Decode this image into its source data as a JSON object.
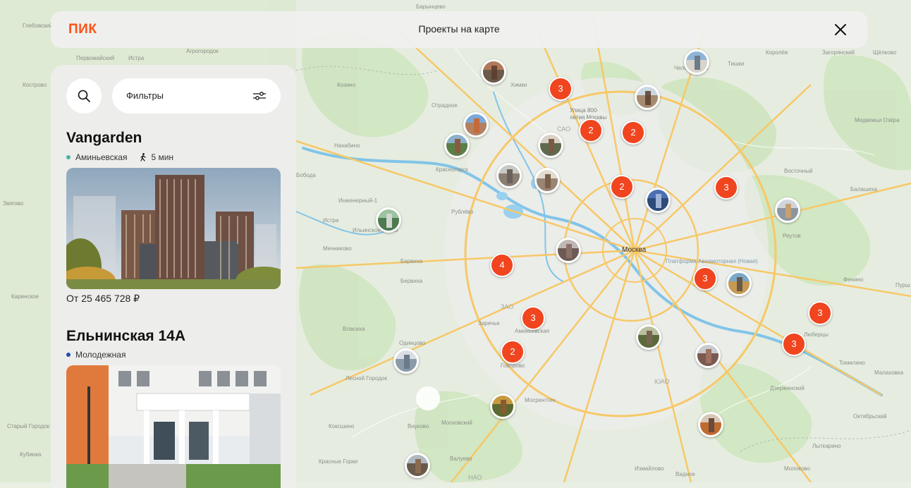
{
  "header": {
    "logo": "ПИК",
    "title": "Проекты на карте"
  },
  "search": {
    "icon": "search-icon"
  },
  "filters": {
    "label": "Фильтры",
    "icon": "sliders-icon"
  },
  "projects": [
    {
      "name": "Vangarden",
      "metro": "Аминьевская",
      "metro_color": "#4fb0a8",
      "walk_time": "5 мин",
      "price": "От 25 465 728 ₽"
    },
    {
      "name": "Ельнинская 14А",
      "metro": "Молодежная",
      "metro_color": "#1f4fb0"
    }
  ],
  "map": {
    "city_label": "Москва",
    "labels": [
      "Глебовский",
      "Первомайский",
      "Истра",
      "Агрогородок",
      "Барынцево",
      "Кострово",
      "Козино",
      "Химки",
      "Отрадное",
      "Нахабино",
      "Красногорск",
      "Бобода",
      "Инженерный-1",
      "Истра",
      "Ильинское-Усово",
      "Рублёво",
      "Мечниково",
      "Барвиха",
      "Бервиха",
      "Каринское",
      "Власиха",
      "Одинцово",
      "Лесной Городок",
      "Заречье",
      "Аминьевская",
      "Говорово",
      "Мосрентген",
      "Московский",
      "Коксшино",
      "Внуково",
      "Ватутинки",
      "Валуево",
      "Красные Горки",
      "Старый Городок",
      "Кубинка",
      "Челобитьево",
      "Королёв",
      "Загорянский",
      "Щёлково",
      "Медвежьи Озёра",
      "Восточный",
      "Балашиха",
      "Реутов",
      "Платформа Авиамоторная (Новая)",
      "Фенино",
      "Люберцы",
      "Томилино",
      "Малаховка",
      "Дзержинский",
      "Октябрьский",
      "Лыткарино",
      "Молоково",
      "Видное",
      "Измайлово",
      "Улица 800-летия Москвы",
      "Видное",
      "Пурш",
      "Звягово",
      "Тишки",
      "Лобня",
      "Газорка"
    ],
    "districts": [
      "САО",
      "ЗАО",
      "ЮАО",
      "НАО"
    ],
    "clusters": [
      "3",
      "2",
      "2",
      "2",
      "3",
      "4",
      "3",
      "3",
      "3",
      "2",
      "3"
    ]
  }
}
